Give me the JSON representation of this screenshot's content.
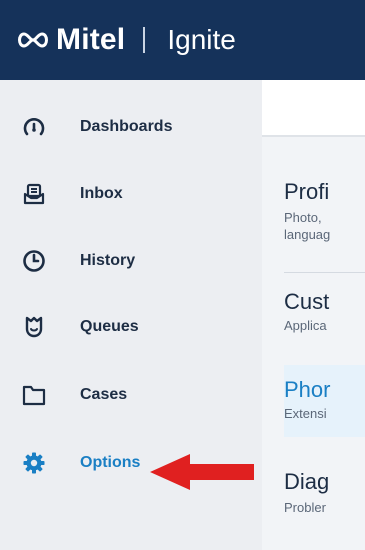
{
  "header": {
    "brand": "Mitel",
    "product": "Ignite"
  },
  "sidebar": {
    "items": [
      {
        "label": "Dashboards",
        "icon": "gauge-icon",
        "active": false
      },
      {
        "label": "Inbox",
        "icon": "inbox-icon",
        "active": false
      },
      {
        "label": "History",
        "icon": "clock-icon",
        "active": false
      },
      {
        "label": "Queues",
        "icon": "queue-icon",
        "active": false
      },
      {
        "label": "Cases",
        "icon": "folder-icon",
        "active": false
      },
      {
        "label": "Options",
        "icon": "gear-icon",
        "active": true
      }
    ]
  },
  "options": {
    "items": [
      {
        "title": "Profi",
        "description_line1": "Photo,",
        "description_line2": "languag"
      },
      {
        "title": "Cust",
        "description_line1": "Applica"
      },
      {
        "title": "Phor",
        "description_line1": "Extensi"
      },
      {
        "title": "Diag",
        "description_line1": "Probler"
      }
    ]
  },
  "colors": {
    "header": "#15325a",
    "accent": "#1a7fc4",
    "sidebar": "#eceef2",
    "annotation_arrow": "#e02020"
  }
}
